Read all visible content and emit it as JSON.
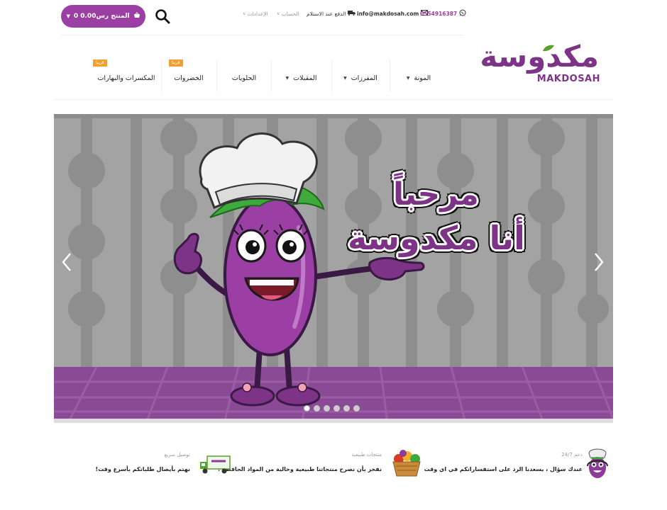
{
  "cart": {
    "label": "0 المنتج رس0.00"
  },
  "topbar": {
    "phone": "0554916387",
    "email": "info@makdosah.com",
    "cod": "الدفع عند الاستلام",
    "account": "الحساب",
    "settings": "الإعدادات"
  },
  "logo": {
    "arabic": "مكدوسة",
    "latin": "MAKDOSAH"
  },
  "nav": {
    "items": [
      {
        "label": "المونة",
        "has_dropdown": true
      },
      {
        "label": "المفرزات",
        "has_dropdown": true
      },
      {
        "label": "المقبلات",
        "has_dropdown": true
      },
      {
        "label": "الحلويات",
        "has_dropdown": false
      },
      {
        "label": "الخضروات",
        "has_dropdown": false,
        "badge": "قريبا"
      },
      {
        "label": "المكسرات والبهارات",
        "has_dropdown": false,
        "badge": "قريبا"
      }
    ]
  },
  "slider": {
    "greeting_line1": "مرحباً",
    "greeting_line2": "أنا مكدوسة",
    "slide_count": 6,
    "active_slide": 1
  },
  "features": [
    {
      "title": "دعم 24/7",
      "desc": "عندك سؤال ، يسعدنا الرد على استفساراتكم في اي وقت"
    },
    {
      "title": "منتجات طبيعية",
      "desc": "نفخر بأن نصرح منتجاتنا طبيعية وخالية من المواد الحافظة !"
    },
    {
      "title": "توصيل سريع",
      "desc": "نهتم بأيصال طلباتكم بأسرع وقت!"
    }
  ],
  "colors": {
    "brand": "#9b3fa5",
    "badge": "#f0a030"
  }
}
